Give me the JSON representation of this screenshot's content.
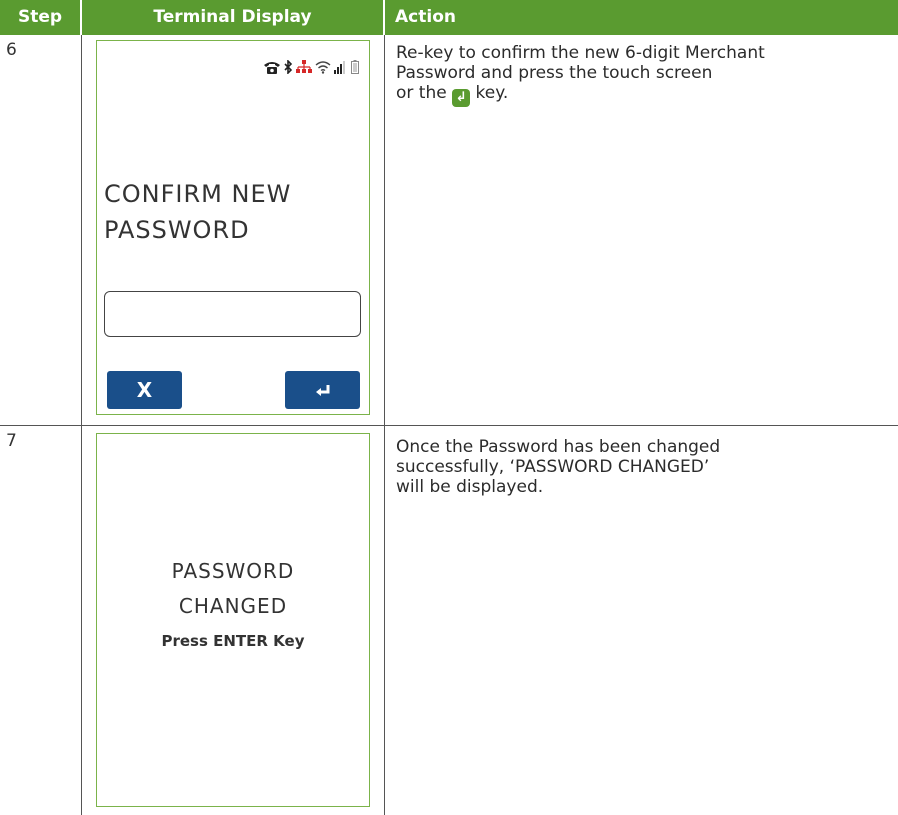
{
  "header": {
    "step": "Step",
    "terminal_display": "Terminal Display",
    "action": "Action"
  },
  "rows": [
    {
      "step": "6",
      "screen": {
        "title_line1": "CONFIRM NEW",
        "title_line2": "PASSWORD",
        "cancel_label": "X",
        "enter_label": "↵"
      },
      "action": {
        "line1": "Re-key to confirm the new 6-digit Merchant",
        "line2": "Password and press the touch screen",
        "line3_before": "or the",
        "line3_after": "key."
      }
    },
    {
      "step": "7",
      "screen": {
        "line1": "PASSWORD",
        "line2": "CHANGED",
        "line3": "Press ENTER Key"
      },
      "action": {
        "line1": "Once the Password has been changed",
        "line2": "successfully, ‘PASSWORD CHANGED’",
        "line3": "will be displayed."
      }
    }
  ],
  "colors": {
    "header_green": "#5a9b30",
    "button_blue": "#1a4f8a",
    "screen_border": "#7bb34a"
  }
}
